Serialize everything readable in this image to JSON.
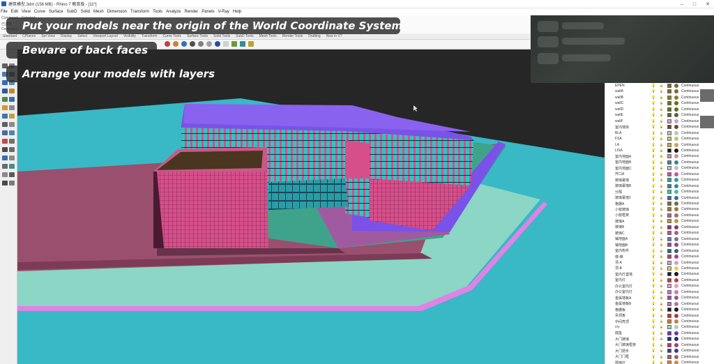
{
  "window": {
    "title": "建筑模型.3dm (156 MB) - Rhino 7 教育版 - [11*]",
    "controls": [
      "–",
      "□",
      "✕"
    ]
  },
  "menubar": [
    "File",
    "Edit",
    "View",
    "Curve",
    "Surface",
    "SubD",
    "Solid",
    "Mesh",
    "Dimension",
    "Transform",
    "Tools",
    "Analyze",
    "Render",
    "Panels",
    "V-Ray",
    "Help"
  ],
  "command": {
    "line1": "Command: _Selected",
    "line2": "已选择",
    "line3": "Command:"
  },
  "toolbar_tabs": [
    "Standard",
    "CPlanes",
    "Set View",
    "Display",
    "Select",
    "Viewport Layout",
    "Visibility",
    "Transform",
    "Curve Tools",
    "Surface Tools",
    "Solid Tools",
    "SubD Tools",
    "Mesh Tools",
    "Render Tools",
    "Drafting",
    "New in V7"
  ],
  "captions": {
    "c1": "Put your models near the origin of the World Coordinate System",
    "c2": "Beware of back faces",
    "c3": "Arrange your models with layers"
  },
  "layers": {
    "linetype": "Continuous",
    "rows": [
      {
        "name": "EPEN",
        "color": "#7b6a2e"
      },
      {
        "name": "wallA",
        "color": "#7b6a2e"
      },
      {
        "name": "wallB",
        "color": "#8a7a2a"
      },
      {
        "name": "wallC",
        "color": "#6e6a20"
      },
      {
        "name": "wallD",
        "color": "#5c6a20"
      },
      {
        "name": "wallE",
        "color": "#4e6a2a"
      },
      {
        "name": "wallF",
        "color": "#c8a0d0"
      },
      {
        "name": "室内墙体",
        "color": "#6a4a2a"
      },
      {
        "name": "BLA",
        "color": "#c0c0c0"
      },
      {
        "name": "FSA",
        "color": "#b5cc6a"
      },
      {
        "name": "LA",
        "color": "#c6a84a"
      },
      {
        "name": "LISA",
        "color": "#1a1a1a"
      },
      {
        "name": "室内地面A",
        "color": "#d08aa0"
      },
      {
        "name": "室内地面B",
        "color": "#2e8a8a"
      },
      {
        "name": "室内地面C",
        "color": "#c0c0c0"
      },
      {
        "name": "开口A",
        "color": "#d050a0"
      },
      {
        "name": "玻璃幕墙",
        "color": "#2ea0a0"
      },
      {
        "name": "玻璃幕墙B",
        "color": "#2e8aa0"
      },
      {
        "name": "分隔",
        "color": "#40c0a0"
      },
      {
        "name": "玻璃幕墙2",
        "color": "#3a6aa0"
      },
      {
        "name": "格栅A",
        "color": "#7a6a3a"
      },
      {
        "name": "小窗玻璃",
        "color": "#9a7a3a"
      },
      {
        "name": "小窗框架",
        "color": "#a06a8a"
      },
      {
        "name": "玻璃A",
        "color": "#b0a040"
      },
      {
        "name": "玻璃B",
        "color": "#8a3a6a"
      },
      {
        "name": "玻璃C",
        "color": "#b05a8a"
      },
      {
        "name": "铺地面A",
        "color": "#6a7ab0"
      },
      {
        "name": "铺地面B",
        "color": "#9a4a7a"
      },
      {
        "name": "室内构件",
        "color": "#2a6a6a"
      },
      {
        "name": "楼-梯",
        "color": "#c03a6a"
      },
      {
        "name": "顶-A",
        "color": "#d0a0d0"
      },
      {
        "name": "顶-B",
        "color": "#e0d04a"
      },
      {
        "name": "室内灯盏墙",
        "color": "#1a1a1a"
      },
      {
        "name": "室内灯",
        "color": "#c03a3a"
      },
      {
        "name": "办公室内灯",
        "color": "#e0a0c0"
      },
      {
        "name": "办公室内灯",
        "color": "#e070b0"
      },
      {
        "name": "金属墙板A",
        "color": "#8a5aa0"
      },
      {
        "name": "金属墙板B",
        "color": "#b07aa0"
      },
      {
        "name": "格栅板",
        "color": "#1a1a1a"
      },
      {
        "name": "吊顶板",
        "color": "#b03a3a"
      },
      {
        "name": "中间亮顶",
        "color": "#d07a3a"
      },
      {
        "name": "cry",
        "color": "#a0d0c0"
      },
      {
        "name": "底座",
        "color": "#6a3aa0"
      },
      {
        "name": "大门玻璃",
        "color": "#1a2a8a"
      },
      {
        "name": "大门玻璃框架",
        "color": "#b03a6a"
      },
      {
        "name": "大门把手",
        "color": "#3a3a8a"
      },
      {
        "name": "大门门框",
        "color": "#b05a5a"
      },
      {
        "name": "围墙灯",
        "color": "#d08a3a"
      }
    ]
  },
  "colors": {
    "ground": "#39b8c6",
    "roof": "#7a52e8",
    "podium": "#9b4f6e",
    "facade": "#d64f8a",
    "glass": "#31c4c4",
    "path": "#8bd6c4"
  }
}
